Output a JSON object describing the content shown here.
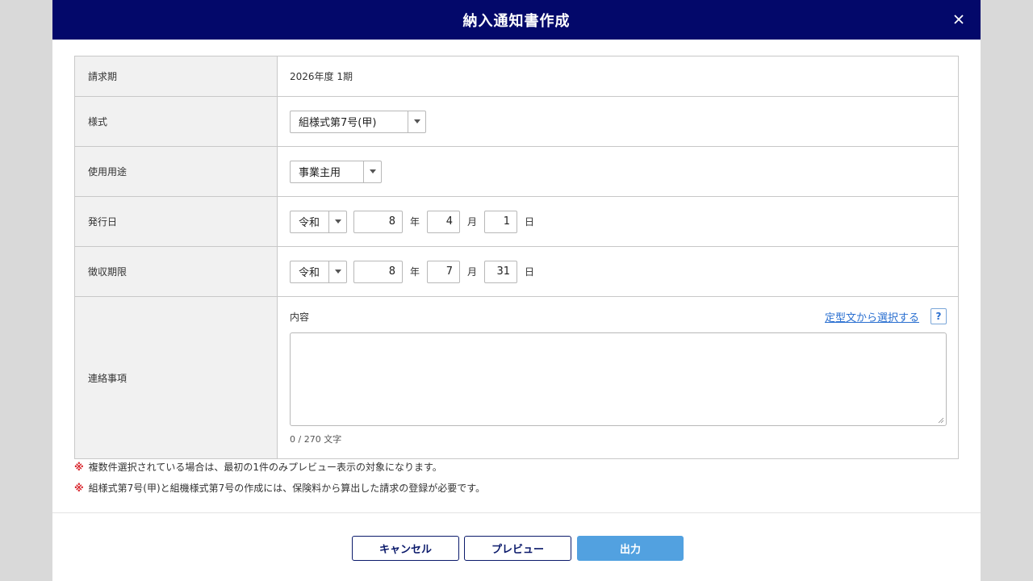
{
  "modal": {
    "title": "納入通知書作成"
  },
  "form": {
    "billing_period": {
      "label": "請求期",
      "value": "2026年度 1期"
    },
    "format": {
      "label": "様式",
      "selected": "組様式第7号(甲)"
    },
    "usage": {
      "label": "使用用途",
      "selected": "事業主用"
    },
    "issue_date": {
      "label": "発行日",
      "era": "令和",
      "year": "8",
      "year_unit": "年",
      "month": "4",
      "month_unit": "月",
      "day": "1",
      "day_unit": "日"
    },
    "due_date": {
      "label": "徴収期限",
      "era": "令和",
      "year": "8",
      "year_unit": "年",
      "month": "7",
      "month_unit": "月",
      "day": "31",
      "day_unit": "日"
    },
    "notes": {
      "label": "連絡事項",
      "content_label": "内容",
      "template_link": "定型文から選択する",
      "help": "?",
      "value": "",
      "counter": "0 / 270 文字"
    }
  },
  "notices": [
    {
      "mark": "※",
      "text": "複数件選択されている場合は、最初の1件のみプレビュー表示の対象になります。"
    },
    {
      "mark": "※",
      "text": "組様式第7号(甲)と組機様式第7号の作成には、保険料から算出した請求の登録が必要です。"
    }
  ],
  "buttons": {
    "cancel": "キャンセル",
    "preview": "プレビュー",
    "output": "出力"
  },
  "colors": {
    "header_bg": "#03086a",
    "primary_button": "#52a1e0",
    "link": "#2a6fd0",
    "notice_mark": "#d9272e"
  }
}
